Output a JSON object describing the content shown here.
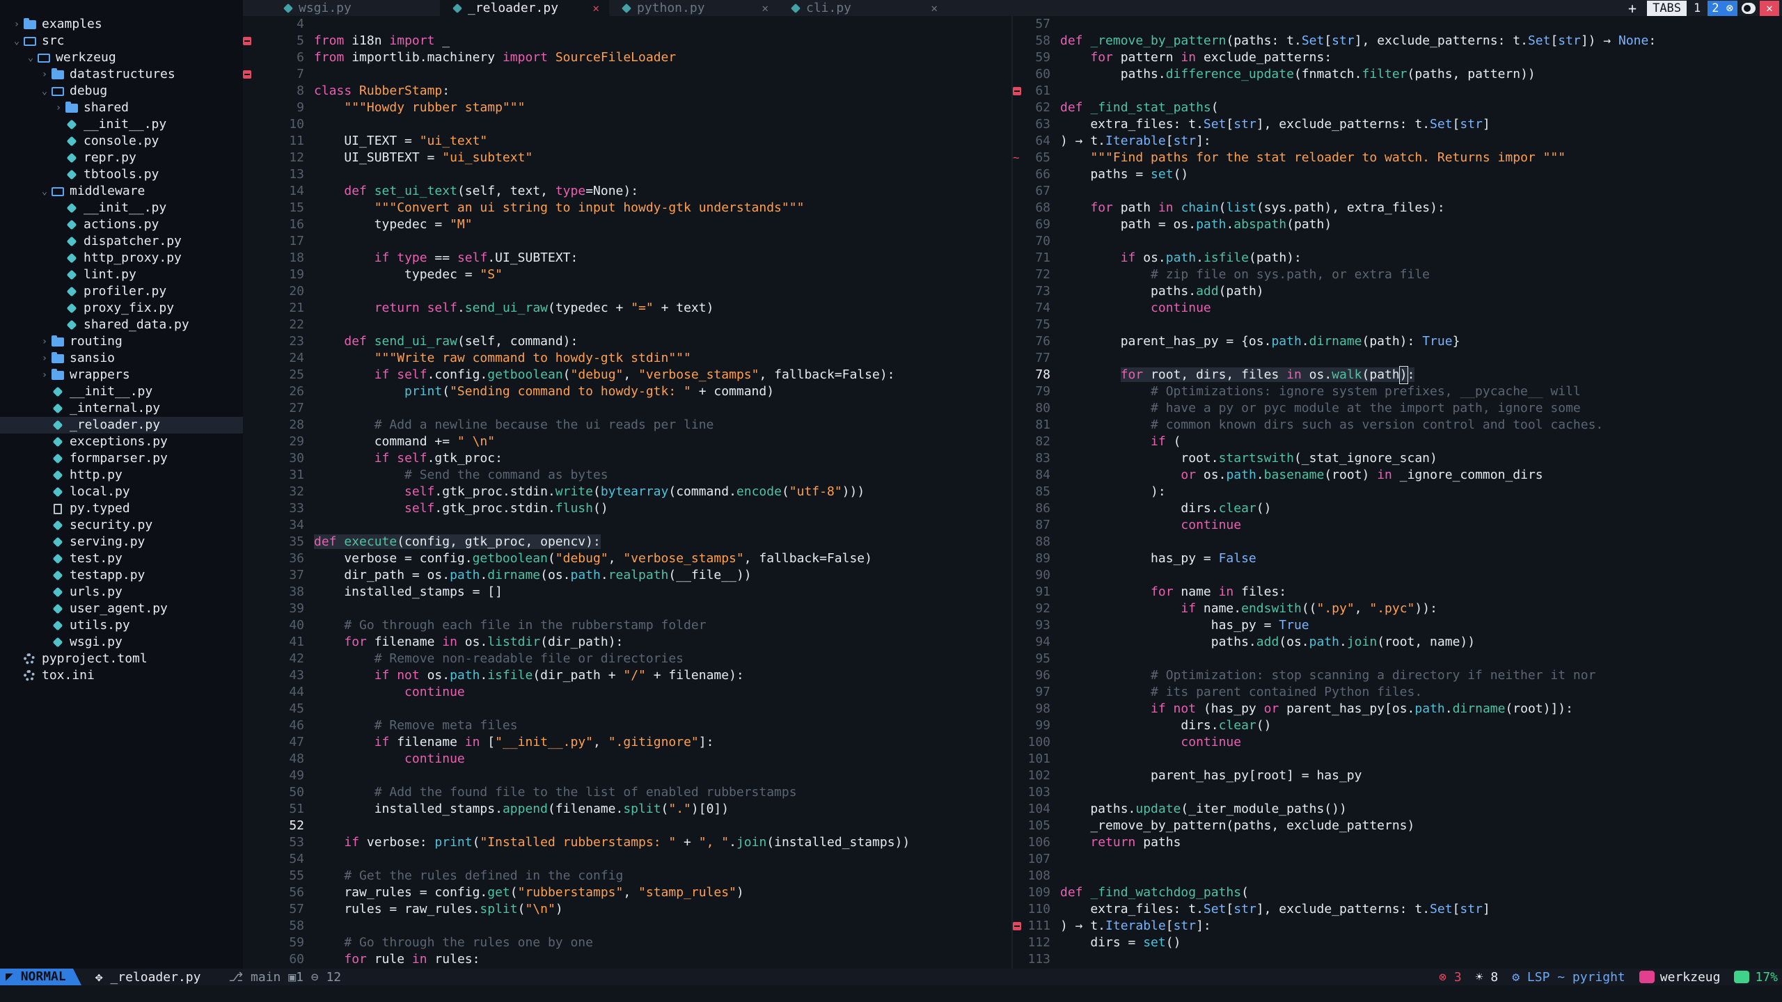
{
  "sidebar": {
    "items": [
      {
        "d": 0,
        "t": "folder",
        "tw": "›",
        "l": "examples"
      },
      {
        "d": 0,
        "t": "folder-open",
        "tw": "⌄",
        "l": "src"
      },
      {
        "d": 1,
        "t": "folder-open",
        "tw": "⌄",
        "l": "werkzeug"
      },
      {
        "d": 2,
        "t": "folder",
        "tw": "›",
        "l": "datastructures"
      },
      {
        "d": 2,
        "t": "folder-open",
        "tw": "⌄",
        "l": "debug"
      },
      {
        "d": 3,
        "t": "folder",
        "tw": "›",
        "l": "shared"
      },
      {
        "d": 3,
        "t": "py",
        "l": "__init__.py"
      },
      {
        "d": 3,
        "t": "py",
        "l": "console.py"
      },
      {
        "d": 3,
        "t": "py",
        "l": "repr.py"
      },
      {
        "d": 3,
        "t": "py",
        "l": "tbtools.py"
      },
      {
        "d": 2,
        "t": "folder-open",
        "tw": "⌄",
        "l": "middleware"
      },
      {
        "d": 3,
        "t": "py",
        "l": "__init__.py"
      },
      {
        "d": 3,
        "t": "py",
        "l": "actions.py"
      },
      {
        "d": 3,
        "t": "py",
        "l": "dispatcher.py"
      },
      {
        "d": 3,
        "t": "py",
        "l": "http_proxy.py"
      },
      {
        "d": 3,
        "t": "py",
        "l": "lint.py"
      },
      {
        "d": 3,
        "t": "py",
        "l": "profiler.py"
      },
      {
        "d": 3,
        "t": "py",
        "l": "proxy_fix.py"
      },
      {
        "d": 3,
        "t": "py",
        "l": "shared_data.py"
      },
      {
        "d": 2,
        "t": "folder",
        "tw": "›",
        "l": "routing"
      },
      {
        "d": 2,
        "t": "folder",
        "tw": "›",
        "l": "sansio"
      },
      {
        "d": 2,
        "t": "folder",
        "tw": "›",
        "l": "wrappers"
      },
      {
        "d": 2,
        "t": "py",
        "l": "__init__.py"
      },
      {
        "d": 2,
        "t": "py",
        "l": "_internal.py"
      },
      {
        "d": 2,
        "t": "py",
        "l": "_reloader.py",
        "sel": true
      },
      {
        "d": 2,
        "t": "py",
        "l": "exceptions.py"
      },
      {
        "d": 2,
        "t": "py",
        "l": "formparser.py"
      },
      {
        "d": 2,
        "t": "py",
        "l": "http.py"
      },
      {
        "d": 2,
        "t": "py",
        "l": "local.py"
      },
      {
        "d": 2,
        "t": "file",
        "l": "py.typed"
      },
      {
        "d": 2,
        "t": "py",
        "l": "security.py"
      },
      {
        "d": 2,
        "t": "py",
        "l": "serving.py"
      },
      {
        "d": 2,
        "t": "py",
        "l": "test.py"
      },
      {
        "d": 2,
        "t": "py",
        "l": "testapp.py"
      },
      {
        "d": 2,
        "t": "py",
        "l": "urls.py"
      },
      {
        "d": 2,
        "t": "py",
        "l": "user_agent.py"
      },
      {
        "d": 2,
        "t": "py",
        "l": "utils.py"
      },
      {
        "d": 2,
        "t": "py",
        "l": "wsgi.py"
      },
      {
        "d": 0,
        "t": "gear",
        "l": "pyproject.toml"
      },
      {
        "d": 0,
        "t": "gear",
        "l": "tox.ini"
      }
    ]
  },
  "tabs": [
    {
      "label": "wsgi.py",
      "active": false,
      "close": false
    },
    {
      "label": "_reloader.py",
      "active": true,
      "close": true
    },
    {
      "label": "python.py",
      "active": false,
      "close": true
    },
    {
      "label": "cli.py",
      "active": false,
      "close": true
    }
  ],
  "tabbar_right": {
    "plus": "+",
    "tabs_label": "TABS",
    "n1": "1",
    "n2": "2 ⊗",
    "close": "✕"
  },
  "colors": {
    "keyword": "#ec5fb1",
    "string": "#ffa04f",
    "func": "#4fc3a4",
    "builtin": "#4fc3d9",
    "comment": "#5c6573",
    "type": "#78b5ff",
    "cls": "#ffa04f",
    "num": "#ffa04f",
    "accent": "#2f7de1",
    "error": "#e2485e"
  },
  "left_pane": {
    "cursor_line": 52,
    "lines": [
      {
        "n": 4,
        "c": ""
      },
      {
        "n": 5,
        "s": "m",
        "c": "[k]from[/] i18n [k]import[/] _"
      },
      {
        "n": 6,
        "c": "[k]from[/] importlib.machinery [k]import[/] [s]SourceFileLoader[/]"
      },
      {
        "n": 7,
        "s": "m",
        "c": ""
      },
      {
        "n": 8,
        "c": "[k]class[/] [s]RubberStamp[/]:"
      },
      {
        "n": 9,
        "c": "    [s]\"\"\"Howdy rubber stamp\"\"\"[/]"
      },
      {
        "n": 10,
        "c": ""
      },
      {
        "n": 11,
        "c": "    UI_TEXT = [s]\"ui_text\"[/]"
      },
      {
        "n": 12,
        "c": "    UI_SUBTEXT = [s]\"ui_subtext\"[/]"
      },
      {
        "n": 13,
        "c": ""
      },
      {
        "n": 14,
        "c": "    [k]def[/] [f]set_ui_text[/](self, text, [k]type[/]=None):"
      },
      {
        "n": 15,
        "c": "        [s]\"\"\"Convert an ui string to input howdy-gtk understands\"\"\"[/]"
      },
      {
        "n": 16,
        "c": "        typedec = [s]\"M\"[/]"
      },
      {
        "n": 17,
        "c": ""
      },
      {
        "n": 18,
        "c": "        [k]if[/] [k]type[/] == [k]self[/].UI_SUBTEXT:"
      },
      {
        "n": 19,
        "c": "            typedec = [s]\"S\"[/]"
      },
      {
        "n": 20,
        "c": ""
      },
      {
        "n": 21,
        "c": "        [k]return[/] [k]self[/].[f]send_ui_raw[/](typedec + [s]\"=\"[/] + text)"
      },
      {
        "n": 22,
        "c": ""
      },
      {
        "n": 23,
        "c": "    [k]def[/] [f]send_ui_raw[/](self, command):"
      },
      {
        "n": 24,
        "c": "        [s]\"\"\"Write raw command to howdy-gtk stdin\"\"\"[/]"
      },
      {
        "n": 25,
        "c": "        [k]if[/] [k]self[/].config.[f]getboolean[/]([s]\"debug\"[/], [s]\"verbose_stamps\"[/], fallback=False):"
      },
      {
        "n": 26,
        "c": "            [b]print[/]([s]\"Sending command to howdy-gtk: \"[/] + command)"
      },
      {
        "n": 27,
        "c": ""
      },
      {
        "n": 28,
        "c": "        [c]# Add a newline because the ui reads per line[/]"
      },
      {
        "n": 29,
        "c": "        command += [s]\" \\n\"[/]"
      },
      {
        "n": 30,
        "c": "        [k]if[/] [k]self[/].gtk_proc:"
      },
      {
        "n": 31,
        "c": "            [c]# Send the command as bytes[/]"
      },
      {
        "n": 32,
        "c": "            [k]self[/].gtk_proc.stdin.[f]write[/]([b]bytearray[/](command.[f]encode[/]([s]\"utf-8\"[/])))"
      },
      {
        "n": 33,
        "c": "            [k]self[/].gtk_proc.stdin.[f]flush[/]()"
      },
      {
        "n": 34,
        "c": ""
      },
      {
        "n": 35,
        "hl": true,
        "c": "[k]def[/] [f]execute[/](config, gtk_proc, opencv):"
      },
      {
        "n": 36,
        "c": "    verbose = config.[f]getboolean[/]([s]\"debug\"[/], [s]\"verbose_stamps\"[/], fallback=False)"
      },
      {
        "n": 37,
        "c": "    dir_path = os.[b]path[/].[f]dirname[/](os.[b]path[/].[f]realpath[/](__file__))"
      },
      {
        "n": 38,
        "c": "    installed_stamps = []"
      },
      {
        "n": 39,
        "c": ""
      },
      {
        "n": 40,
        "c": "    [c]# Go through each file in the rubberstamp folder[/]"
      },
      {
        "n": 41,
        "c": "    [k]for[/] filename [k]in[/] os.[f]listdir[/](dir_path):"
      },
      {
        "n": 42,
        "c": "        [c]# Remove non-readable file or directories[/]"
      },
      {
        "n": 43,
        "c": "        [k]if not[/] os.[b]path[/].[f]isfile[/](dir_path + [s]\"/\"[/] + filename):"
      },
      {
        "n": 44,
        "c": "            [k]continue[/]"
      },
      {
        "n": 45,
        "c": ""
      },
      {
        "n": 46,
        "c": "        [c]# Remove meta files[/]"
      },
      {
        "n": 47,
        "c": "        [k]if[/] filename [k]in[/] [[s]\"__init__.py\"[/], [s]\".gitignore\"[/]]:"
      },
      {
        "n": 48,
        "c": "            [k]continue[/]"
      },
      {
        "n": 49,
        "c": ""
      },
      {
        "n": 50,
        "c": "        [c]# Add the found file to the list of enabled rubberstamps[/]"
      },
      {
        "n": 51,
        "c": "        installed_stamps.[f]append[/](filename.[f]split[/]([s]\".\"[/])[0])"
      },
      {
        "n": 52,
        "c": ""
      },
      {
        "n": 53,
        "c": "    [k]if[/] verbose: [b]print[/]([s]\"Installed rubberstamps: \"[/] + [s]\", \"[/].[f]join[/](installed_stamps))"
      },
      {
        "n": 54,
        "c": ""
      },
      {
        "n": 55,
        "c": "    [c]# Get the rules defined in the config[/]"
      },
      {
        "n": 56,
        "c": "    raw_rules = config.[f]get[/]([s]\"rubberstamps\"[/], [s]\"stamp_rules\"[/])"
      },
      {
        "n": 57,
        "c": "    rules = raw_rules.[f]split[/]([s]\"\\n\"[/])"
      },
      {
        "n": 58,
        "c": ""
      },
      {
        "n": 59,
        "c": "    [c]# Go through the rules one by one[/]"
      },
      {
        "n": 60,
        "c": "    [k]for[/] rule [k]in[/] rules:"
      }
    ]
  },
  "right_pane": {
    "cursor_line": 78,
    "lines": [
      {
        "n": 57,
        "c": ""
      },
      {
        "n": 58,
        "c": "[k]def[/] [f]_remove_by_pattern[/](paths: t.[t]Set[/][[t]str[/]], exclude_patterns: t.[t]Set[/][[t]str[/]]) → [t]None[/]:"
      },
      {
        "n": 59,
        "c": "    [k]for[/] pattern [k]in[/] exclude_patterns:"
      },
      {
        "n": 60,
        "c": "        paths.[f]difference_update[/](fnmatch.[f]filter[/](paths, pattern))"
      },
      {
        "n": 61,
        "s": "m",
        "c": ""
      },
      {
        "n": 62,
        "c": "[k]def[/] [f]_find_stat_paths[/]("
      },
      {
        "n": 63,
        "c": "    extra_files: t.[t]Set[/][[t]str[/]], exclude_patterns: t.[t]Set[/][[t]str[/]]"
      },
      {
        "n": 64,
        "c": ") → t.[t]Iterable[/][[t]str[/]]:"
      },
      {
        "n": 65,
        "s": "~",
        "c": "    [s]\"\"\"Find paths for the stat reloader to watch. Returns impor \"\"\"[/]"
      },
      {
        "n": 66,
        "c": "    paths = [b]set[/]()"
      },
      {
        "n": 67,
        "c": ""
      },
      {
        "n": 68,
        "c": "    [k]for[/] path [k]in[/] [b]chain[/]([b]list[/](sys.path), extra_files):"
      },
      {
        "n": 69,
        "c": "        path = os.[b]path[/].[f]abspath[/](path)"
      },
      {
        "n": 70,
        "c": ""
      },
      {
        "n": 71,
        "c": "        [k]if[/] os.[b]path[/].[f]isfile[/](path):"
      },
      {
        "n": 72,
        "c": "            [c]# zip file on sys.path, or extra file[/]"
      },
      {
        "n": 73,
        "c": "            paths.[f]add[/](path)"
      },
      {
        "n": 74,
        "c": "            [k]continue[/]"
      },
      {
        "n": 75,
        "c": ""
      },
      {
        "n": 76,
        "c": "        parent_has_py = {os.[b]path[/].[f]dirname[/](path): [t]True[/]}"
      },
      {
        "n": 77,
        "c": ""
      },
      {
        "n": 78,
        "cur": true,
        "c": "        [k]for[/] root, dirs, files [k]in[/] os.[f]walk[/](path[x]):"
      },
      {
        "n": 79,
        "c": "            [c]# Optimizations: ignore system prefixes, __pycache__ will[/]"
      },
      {
        "n": 80,
        "c": "            [c]# have a py or pyc module at the import path, ignore some[/]"
      },
      {
        "n": 81,
        "c": "            [c]# common known dirs such as version control and tool caches.[/]"
      },
      {
        "n": 82,
        "c": "            [k]if[/] ("
      },
      {
        "n": 83,
        "c": "                root.[f]startswith[/](_stat_ignore_scan)"
      },
      {
        "n": 84,
        "c": "                [k]or[/] os.[b]path[/].[f]basename[/](root) [k]in[/] _ignore_common_dirs"
      },
      {
        "n": 85,
        "c": "            ):"
      },
      {
        "n": 86,
        "c": "                dirs.[f]clear[/]()"
      },
      {
        "n": 87,
        "c": "                [k]continue[/]"
      },
      {
        "n": 88,
        "c": ""
      },
      {
        "n": 89,
        "c": "            has_py = [t]False[/]"
      },
      {
        "n": 90,
        "c": ""
      },
      {
        "n": 91,
        "c": "            [k]for[/] name [k]in[/] files:"
      },
      {
        "n": 92,
        "c": "                [k]if[/] name.[f]endswith[/](([s]\".py\"[/], [s]\".pyc\"[/])):"
      },
      {
        "n": 93,
        "c": "                    has_py = [t]True[/]"
      },
      {
        "n": 94,
        "c": "                    paths.[f]add[/](os.[b]path[/].[f]join[/](root, name))"
      },
      {
        "n": 95,
        "c": ""
      },
      {
        "n": 96,
        "c": "            [c]# Optimization: stop scanning a directory if neither it nor[/]"
      },
      {
        "n": 97,
        "c": "            [c]# its parent contained Python files.[/]"
      },
      {
        "n": 98,
        "c": "            [k]if not[/] (has_py [k]or[/] parent_has_py[os.[b]path[/].[f]dirname[/](root)]):"
      },
      {
        "n": 99,
        "c": "                dirs.[f]clear[/]()"
      },
      {
        "n": 100,
        "c": "                [k]continue[/]"
      },
      {
        "n": 101,
        "c": ""
      },
      {
        "n": 102,
        "c": "            parent_has_py[root] = has_py"
      },
      {
        "n": 103,
        "c": ""
      },
      {
        "n": 104,
        "c": "    paths.[f]update[/](_iter_module_paths())"
      },
      {
        "n": 105,
        "c": "    _remove_by_pattern(paths, exclude_patterns)"
      },
      {
        "n": 106,
        "c": "    [k]return[/] paths"
      },
      {
        "n": 107,
        "c": ""
      },
      {
        "n": 108,
        "c": ""
      },
      {
        "n": 109,
        "c": "[k]def[/] [f]_find_watchdog_paths[/]("
      },
      {
        "n": 110,
        "c": "    extra_files: t.[t]Set[/][[t]str[/]], exclude_patterns: t.[t]Set[/][[t]str[/]]"
      },
      {
        "n": 111,
        "s": "m",
        "c": ") → t.[t]Iterable[/][[t]str[/]]:"
      },
      {
        "n": 112,
        "c": "    dirs = [b]set[/]()"
      },
      {
        "n": 113,
        "c": ""
      }
    ]
  },
  "status": {
    "mode": "NORMAL",
    "file": "_reloader.py",
    "branch": "main",
    "changes": "1",
    "warnings": "12",
    "errors": "3",
    "hints": "8",
    "lsp": "LSP ~ pyright",
    "project": "werkzeug",
    "percent": "17%"
  }
}
